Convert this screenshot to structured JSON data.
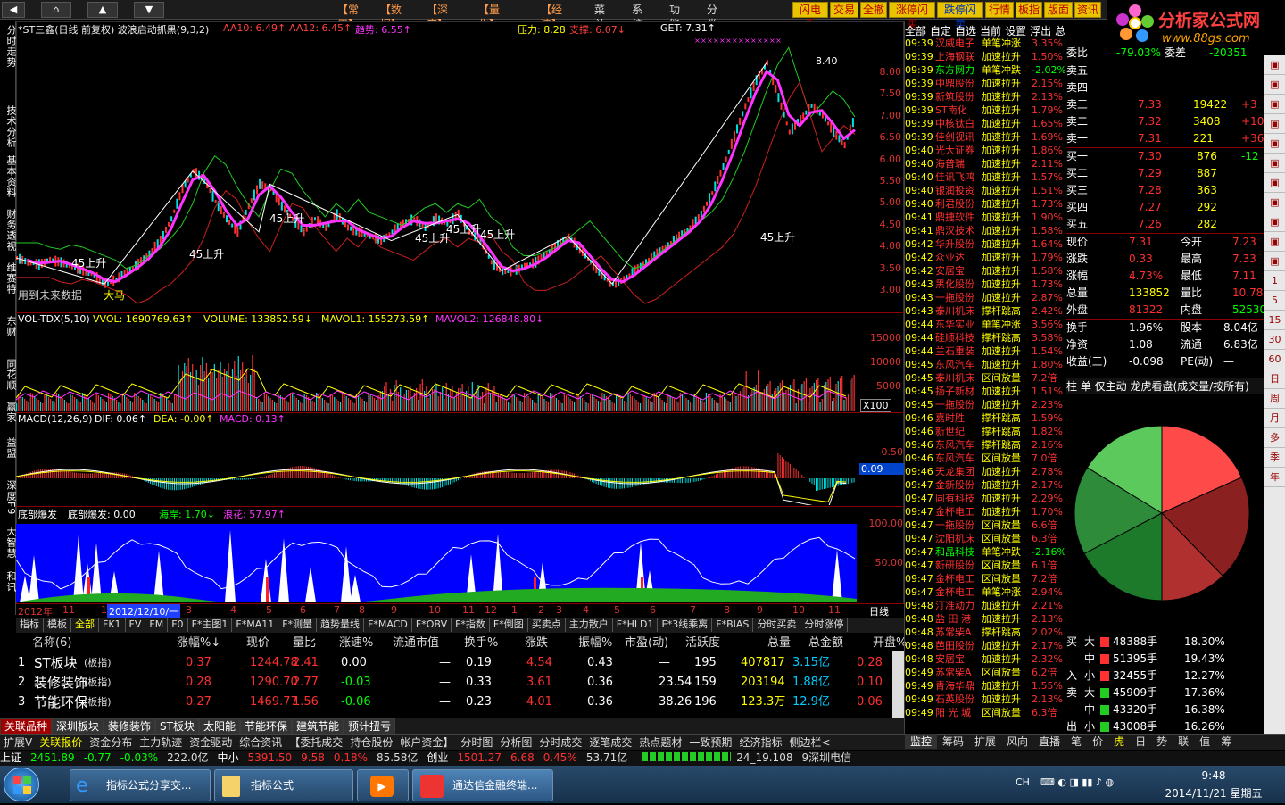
{
  "top": {
    "nav_up": "▲",
    "nav_down": "▼",
    "menus": [
      "【常用】",
      "【数据】",
      "【深度】",
      "【量化】",
      "【经济】",
      "菜单",
      "系统",
      "功能",
      "分类"
    ],
    "quick": [
      "闪电手",
      "交易",
      "全撤",
      "涨停闪买",
      "跌停闪卖",
      "行情",
      "板指",
      "版面",
      "资讯"
    ],
    "logo_text": "分析家公式网",
    "logo_url": "www.88gs.com"
  },
  "sidebar": [
    "分时走势",
    "技术分析",
    "基本资料",
    "财务透视",
    "维赛特",
    "东财",
    "同花顺",
    "赢家",
    "益盟",
    "深度F9",
    "大智慧",
    "和讯"
  ],
  "main": {
    "title": "*ST三鑫(日线 前复权) 波浪启动抓黑(9,3,2)",
    "aa10": "AA10: 6.49↑",
    "aa12": "AA12: 6.45↑",
    "trend": "趋势: 6.55↑",
    "pressure": "压力: 8.28",
    "support": "支撑: 6.07↓",
    "get": "GET: 7.31↑",
    "top_price": "8.40",
    "note": "用到未来数据",
    "bigma": "大马",
    "labels": [
      {
        "t": "45上升"
      },
      {
        "t": "45上升"
      },
      {
        "t": "45上升"
      },
      {
        "t": "45上升"
      },
      {
        "t": "45上升"
      },
      {
        "t": "45上升"
      },
      {
        "t": "45上升"
      }
    ],
    "axis": [
      "8.00",
      "7.50",
      "7.00",
      "6.50",
      "6.00",
      "5.50",
      "5.00",
      "4.50",
      "4.00",
      "3.50",
      "3.00"
    ]
  },
  "vol": {
    "title": "VOL-TDX(5,10)",
    "vvol": "VVOL: 1690769.63↑",
    "volume": "VOLUME: 133852.59↓",
    "mavol1": "MAVOL1: 155273.59↑",
    "mavol2": "MAVOL2: 126848.80↓",
    "axis": [
      "15000",
      "10000",
      "5000"
    ],
    "x100": "X100"
  },
  "macd": {
    "title": "MACD(12,26,9)",
    "dif": "DIF: 0.06↑",
    "dea": "DEA: -0.00↑",
    "macd": "MACD: 0.13↑",
    "axis": [
      "0.50",
      "0.09"
    ]
  },
  "bottom_ind": {
    "title": "底部爆发",
    "value": "底部爆发: 0.00",
    "haian": "海岸: 1.70↓",
    "langhua": "浪花: 57.97↑",
    "axis": [
      "100.00",
      "50.00"
    ]
  },
  "dates": {
    "year": "2012年",
    "sel": "2012/12/10/一",
    "months": [
      "11",
      "1",
      "3",
      "4",
      "5",
      "6",
      "7",
      "8",
      "9",
      "10",
      "11",
      "12",
      "1",
      "2",
      "3",
      "4",
      "5",
      "6",
      "7",
      "8",
      "9",
      "10",
      "11"
    ],
    "mode": "日线"
  },
  "tabs": [
    "指标",
    "模板",
    "全部",
    "FK1",
    "FV",
    "FM",
    "F0",
    "F*主图1",
    "F*MA11",
    "F*测量",
    "趋势量线",
    "F*MACD",
    "F*OBV",
    "F*指数",
    "F*倒图",
    "买卖点",
    "主力散户",
    "F*HLD1",
    "F*3线乘离",
    "F*BIAS",
    "分时买卖",
    "分时涨停"
  ],
  "table": {
    "headers": [
      "名称(6)",
      "涨幅%↓",
      "现价",
      "量比",
      "涨速%",
      "流通市值",
      "换手%",
      "涨跌",
      "振幅%",
      "市盈(动)",
      "活跃度",
      "总量",
      "总金额",
      "开盘%"
    ],
    "rows": [
      [
        "1",
        "ST板块",
        "(板指)",
        "0.37",
        "1244.78",
        "2.41",
        "0.00",
        "—",
        "0.19",
        "4.54",
        "0.43",
        "—",
        "195",
        "407817",
        "3.15亿",
        "0.28"
      ],
      [
        "2",
        "装修装饰",
        "(板指)",
        "0.28",
        "1290.70",
        "2.77",
        "-0.03",
        "—",
        "0.33",
        "3.61",
        "0.36",
        "23.54",
        "159",
        "203194",
        "1.88亿",
        "0.10"
      ],
      [
        "3",
        "节能环保",
        "(板指)",
        "0.27",
        "1469.77",
        "1.56",
        "-0.06",
        "—",
        "0.23",
        "4.01",
        "0.36",
        "38.26",
        "196",
        "123.3万",
        "12.9亿",
        "0.06"
      ]
    ]
  },
  "bottom_tabs": [
    "关联品种",
    "深圳板块",
    "装修装饰",
    "ST板块",
    "太阳能",
    "节能环保",
    "建筑节能",
    "预计扭亏"
  ],
  "bottom_tabs2": [
    "扩展V",
    "关联报价",
    "资金分布",
    "主力轨迹",
    "资金驱动",
    "综合资讯",
    "【委托成交",
    "持仓股份",
    "帐户资金】",
    "分时图",
    "分析图",
    "分时成交",
    "逐笔成交",
    "热点题材",
    "一致预期",
    "经济指标",
    "侧边栏<"
  ],
  "right_tabs": [
    "监控",
    "筹码",
    "扩展",
    "风向",
    "直播",
    "笔",
    "价",
    "虎",
    "日",
    "势",
    "联",
    "值",
    "筹"
  ],
  "status": {
    "sh_label": "上证",
    "sh": "2451.89",
    "sh_chg": "-0.77",
    "sh_pct": "-0.03%",
    "sh_amt": "222.0亿",
    "zx_label": "中小",
    "zx": "5391.50",
    "zx_chg": "9.58",
    "zx_pct": "0.18%",
    "zx_amt": "85.58亿",
    "cy_label": "创业",
    "cy": "1501.27",
    "cy_chg": "6.68",
    "cy_pct": "0.45%",
    "cy_amt": "53.71亿",
    "ticker": "24_19.108",
    "telecom": "9深圳电信"
  },
  "quotes_header": [
    "全部",
    "自定",
    "自选",
    "当前",
    "设置",
    "浮出",
    "总"
  ],
  "quotes": [
    [
      "09:39",
      "汉威电子",
      "单笔冲涨",
      "3.35%"
    ],
    [
      "09:39",
      "上海钢联",
      "加速拉升",
      "1.50%"
    ],
    [
      "09:39",
      "东方网力",
      "单笔冲跌",
      "-2.02%"
    ],
    [
      "09:39",
      "中鼎股份",
      "加速拉升",
      "2.15%"
    ],
    [
      "09:39",
      "新筑股份",
      "加速拉升",
      "2.13%"
    ],
    [
      "09:39",
      "ST南化",
      "加速拉升",
      "1.79%"
    ],
    [
      "09:39",
      "中核钛白",
      "加速拉升",
      "1.65%"
    ],
    [
      "09:39",
      "佳创视讯",
      "加速拉升",
      "1.69%"
    ],
    [
      "09:40",
      "光大证券",
      "加速拉升",
      "1.86%"
    ],
    [
      "09:40",
      "海普瑞",
      "加速拉升",
      "2.11%"
    ],
    [
      "09:40",
      "佳讯飞鸿",
      "加速拉升",
      "1.57%"
    ],
    [
      "09:40",
      "银润投资",
      "加速拉升",
      "1.51%"
    ],
    [
      "09:40",
      "利君股份",
      "加速拉升",
      "1.73%"
    ],
    [
      "09:41",
      "鼎捷软件",
      "加速拉升",
      "1.90%"
    ],
    [
      "09:41",
      "鼎汉技术",
      "加速拉升",
      "1.58%"
    ],
    [
      "09:42",
      "华升股份",
      "加速拉升",
      "1.64%"
    ],
    [
      "09:42",
      "众业达",
      "加速拉升",
      "1.79%"
    ],
    [
      "09:42",
      "安居宝",
      "加速拉升",
      "1.58%"
    ],
    [
      "09:43",
      "黑化股份",
      "加速拉升",
      "1.73%"
    ],
    [
      "09:43",
      "一拖股份",
      "加速拉升",
      "2.87%"
    ],
    [
      "09:43",
      "泰川机床",
      "撑杆跳高",
      "2.42%"
    ],
    [
      "09:44",
      "东华实业",
      "单笔冲涨",
      "3.56%"
    ],
    [
      "09:44",
      "硅顺科技",
      "撑杆跳高",
      "3.58%"
    ],
    [
      "09:44",
      "兰石重装",
      "加速拉升",
      "1.54%"
    ],
    [
      "09:45",
      "东风汽车",
      "加速拉升",
      "1.80%"
    ],
    [
      "09:45",
      "泰川机床",
      "区间放量",
      "7.2倍"
    ],
    [
      "09:45",
      "扬子新材",
      "加速拉升",
      "1.51%"
    ],
    [
      "09:45",
      "一拖股份",
      "加速拉升",
      "2.23%"
    ],
    [
      "09:46",
      "嘉时胜",
      "撑杆跳高",
      "1.59%"
    ],
    [
      "09:46",
      "新世纪",
      "撑杆跳高",
      "1.82%"
    ],
    [
      "09:46",
      "东风汽车",
      "撑杆跳高",
      "2.16%"
    ],
    [
      "09:46",
      "东风汽车",
      "区间放量",
      "7.0倍"
    ],
    [
      "09:46",
      "天龙集团",
      "加速拉升",
      "2.78%"
    ],
    [
      "09:47",
      "金新股份",
      "加速拉升",
      "2.17%"
    ],
    [
      "09:47",
      "同有科技",
      "加速拉升",
      "2.29%"
    ],
    [
      "09:47",
      "金杯电工",
      "加速拉升",
      "1.70%"
    ],
    [
      "09:47",
      "一拖股份",
      "区间放量",
      "6.6倍"
    ],
    [
      "09:47",
      "沈阳机床",
      "区间放量",
      "6.3倍"
    ],
    [
      "09:47",
      "和晶科技",
      "单笔冲跌",
      "-2.16%"
    ],
    [
      "09:47",
      "新研股份",
      "区间放量",
      "6.1倍"
    ],
    [
      "09:47",
      "金杯电工",
      "区间放量",
      "7.2倍"
    ],
    [
      "09:47",
      "金杯电工",
      "单笔冲涨",
      "2.94%"
    ],
    [
      "09:48",
      "汀准动力",
      "加速拉升",
      "2.21%"
    ],
    [
      "09:48",
      "盐 田 港",
      "加速拉升",
      "2.13%"
    ],
    [
      "09:48",
      "苏常柴A",
      "撑杆跳高",
      "2.02%"
    ],
    [
      "09:48",
      "芭田股份",
      "加速拉升",
      "2.17%"
    ],
    [
      "09:48",
      "安居宝",
      "加速拉升",
      "2.32%"
    ],
    [
      "09:49",
      "苏常柴A",
      "区间放量",
      "6.2倍"
    ],
    [
      "09:49",
      "青海华鼎",
      "加速拉升",
      "1.55%"
    ],
    [
      "09:49",
      "石英股份",
      "加速拉升",
      "2.13%"
    ],
    [
      "09:49",
      "阳 光 城",
      "区间放量",
      "6.3倍"
    ]
  ],
  "depth": {
    "wb_label": "委比",
    "wb_val": "-79.03%",
    "wc_label": "委差",
    "wc_val": "-20351",
    "sells": [
      [
        "卖五",
        "",
        "",
        " "
      ],
      [
        "卖四",
        "",
        "",
        ""
      ],
      [
        "卖三",
        "7.33",
        "19422",
        "+3"
      ],
      [
        "卖二",
        "7.32",
        "3408",
        "+10"
      ],
      [
        "卖一",
        "7.31",
        "221",
        "+36"
      ]
    ],
    "buys": [
      [
        "买一",
        "7.30",
        "876",
        "-12"
      ],
      [
        "买二",
        "7.29",
        "887",
        ""
      ],
      [
        "买三",
        "7.28",
        "363",
        ""
      ],
      [
        "买四",
        "7.27",
        "292",
        ""
      ],
      [
        "买五",
        "7.26",
        "282",
        ""
      ]
    ],
    "stats": [
      [
        "现价",
        "7.31",
        "今开",
        "7.23"
      ],
      [
        "涨跌",
        "0.33",
        "最高",
        "7.33"
      ],
      [
        "涨幅",
        "4.73%",
        "最低",
        "7.11"
      ],
      [
        "总量",
        "133852",
        "量比",
        "10.78"
      ],
      [
        "外盘",
        "81322",
        "内盘",
        "52530"
      ]
    ],
    "stats2": [
      [
        "换手",
        "1.96%",
        "股本",
        "8.04亿"
      ],
      [
        "净资",
        "1.08",
        "流通",
        "6.83亿"
      ],
      [
        "收益(三)",
        "-0.098",
        "PE(动)",
        "—"
      ]
    ],
    "tabline": "柱  单  仅主动  龙虎看盘(成交量/按所有)",
    "flows": [
      [
        "大",
        "48388手",
        "18.30%"
      ],
      [
        "中",
        "51395手",
        "19.43%"
      ],
      [
        "小",
        "32455手",
        "12.27%"
      ],
      [
        "大",
        "45909手",
        "17.36%"
      ],
      [
        "中",
        "43320手",
        "16.38%"
      ],
      [
        "小",
        "43008手",
        "16.26%"
      ]
    ],
    "flow_side": [
      "买",
      "入",
      "卖",
      "出"
    ]
  },
  "pie_chart": {
    "values": [
      18.3,
      19.43,
      12.27,
      17.36,
      16.38,
      16.26
    ],
    "colors": [
      "#ff4a4a",
      "#8b2020",
      "#b03030",
      "#1d7a2a",
      "#2e8b3a",
      "#5cc95c"
    ]
  },
  "right_side": [
    "1",
    "5",
    "15",
    "30",
    "60",
    "日",
    "周",
    "月",
    "多",
    "季",
    "年"
  ],
  "clock": {
    "time": "9:48",
    "date": "2014/11/21 星期五",
    "ch": "CH"
  },
  "taskbar": {
    "t1": "指标公式分享交...",
    "t2": "指标公式",
    "t3": "通达信金融终端..."
  }
}
